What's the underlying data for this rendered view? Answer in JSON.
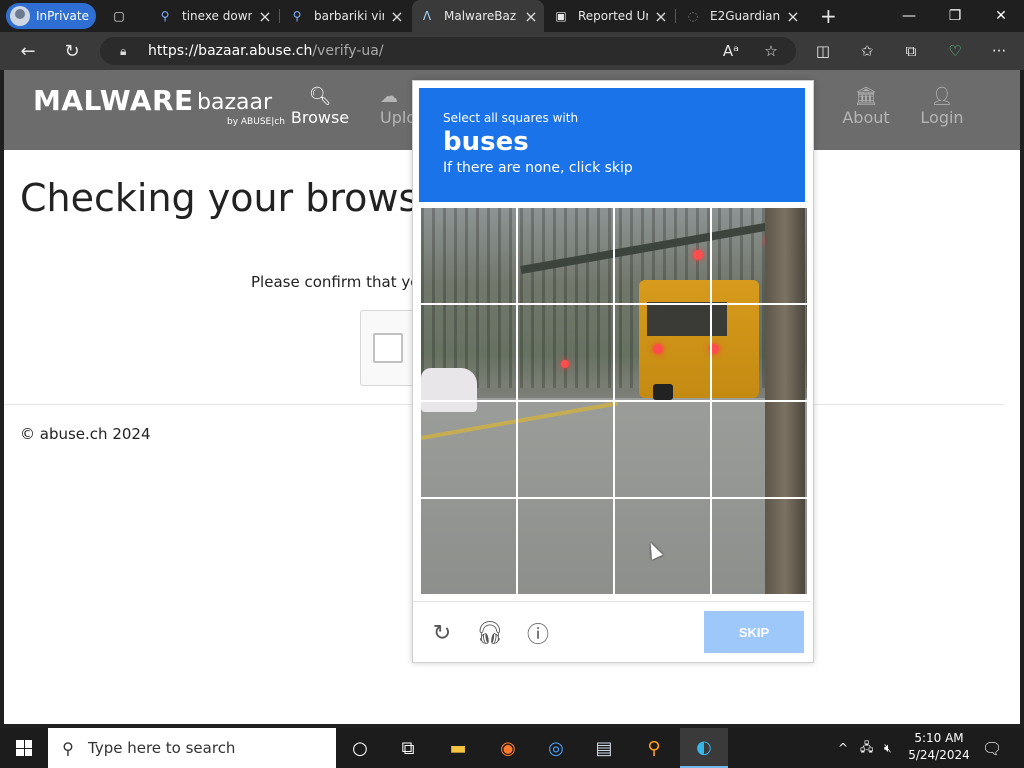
{
  "browser": {
    "inprivate_label": "InPrivate",
    "tabs": [
      {
        "title": "tinexe downl",
        "icon": "search-icon"
      },
      {
        "title": "barbariki vin",
        "icon": "search-icon"
      },
      {
        "title": "MalwareBaz",
        "icon": "malwarebazaar-icon"
      },
      {
        "title": "Reported Ur",
        "icon": "document-icon"
      },
      {
        "title": "E2Guardian",
        "icon": "e2guardian-icon"
      }
    ],
    "url_host": "https://bazaar.abuse.ch",
    "url_path": "/verify-ua/"
  },
  "site": {
    "logo_main": "MALWARE",
    "logo_sub": "bazaar",
    "logo_by": "by ABUSE|ch",
    "nav": [
      {
        "label": "Browse",
        "icon": "search-icon"
      },
      {
        "label": "Uplo",
        "icon": "cloud-upload-icon"
      },
      {
        "label": "About",
        "icon": "building-icon"
      },
      {
        "label": "Login",
        "icon": "user-icon"
      }
    ],
    "heading": "Checking your browse",
    "confirm_text": "Please confirm that you",
    "footer": "© abuse.ch 2024"
  },
  "captcha": {
    "instruction": "Select all squares with",
    "target": "buses",
    "hint": "If there are none, click skip",
    "skip_label": "SKIP"
  },
  "taskbar": {
    "search_placeholder": "Type here to search",
    "time": "5:10 AM",
    "date": "5/24/2024"
  },
  "colors": {
    "captcha_header": "#1a73e8",
    "skip_button": "#9ec8f9",
    "site_header": "#6c6c6c"
  }
}
